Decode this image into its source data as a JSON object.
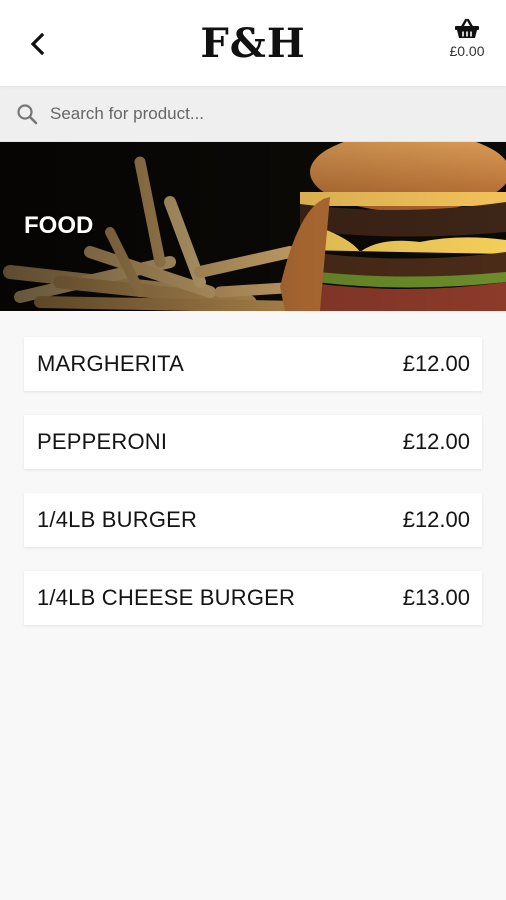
{
  "header": {
    "logo": "F&H",
    "basket_total": "£0.00",
    "back_icon": "chevron-left-icon",
    "basket_icon": "basket-icon"
  },
  "search": {
    "placeholder": "Search for product...",
    "value": "",
    "icon": "search-icon"
  },
  "category": {
    "title": "FOOD"
  },
  "products": [
    {
      "name": "MARGHERITA",
      "price": "£12.00"
    },
    {
      "name": "PEPPERONI",
      "price": "£12.00"
    },
    {
      "name": "1/4LB BURGER",
      "price": "£12.00"
    },
    {
      "name": "1/4LB CHEESE BURGER",
      "price": "£13.00"
    }
  ],
  "colors": {
    "header_bg": "#ffffff",
    "page_bg": "#f8f8f8",
    "search_bg": "#efefef",
    "text": "#141414"
  }
}
